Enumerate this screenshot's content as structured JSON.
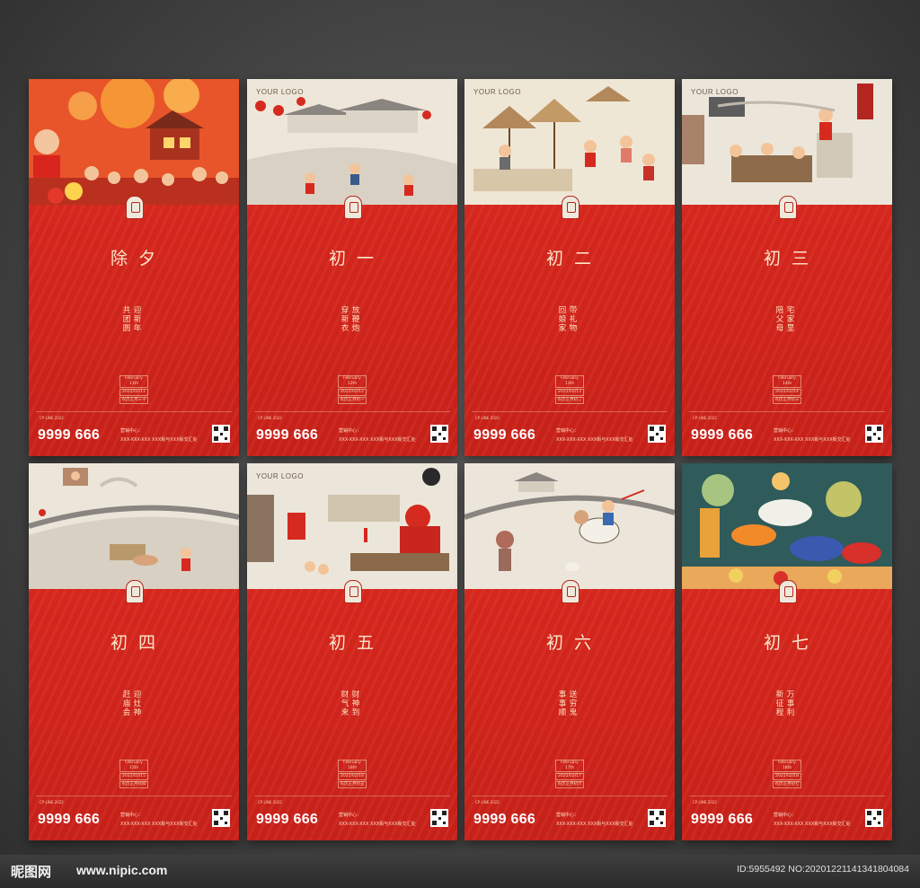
{
  "logo_text": "YOUR LOGO",
  "phone": "9999 666",
  "address_line1": "营销中心：",
  "address_line2": "XXX-XXX-XXX  XXX街与XXX街交汇处",
  "footer_small": "CP LINE 2022",
  "cards": [
    {
      "title": "除夕",
      "sub_a": "迎新年",
      "sub_b": "共团圆",
      "date_en": "February 11th",
      "date_num": "2021/02/11",
      "date_cn": "农历正月三十",
      "scene": "fireworks"
    },
    {
      "title": "初一",
      "sub_a": "放鞭炮",
      "sub_b": "穿新衣",
      "date_en": "February 12th",
      "date_num": "2021/02/12",
      "date_cn": "农历正月初一",
      "scene": "village"
    },
    {
      "title": "初二",
      "sub_a": "带礼物",
      "sub_b": "回娘家",
      "date_en": "February 13th",
      "date_num": "2021/02/13",
      "date_cn": "农历正月初二",
      "scene": "market"
    },
    {
      "title": "初三",
      "sub_a": "宅家里",
      "sub_b": "陪父母",
      "date_en": "February 14th",
      "date_num": "2021/02/14",
      "date_cn": "农历正月初三",
      "scene": "home"
    },
    {
      "title": "初四",
      "sub_a": "迎灶神",
      "sub_b": "赶庙会",
      "date_en": "February 15th",
      "date_num": "2021/02/15",
      "date_cn": "农历正月初四",
      "scene": "courtyard"
    },
    {
      "title": "初五",
      "sub_a": "财神到",
      "sub_b": "财气来",
      "date_en": "February 16th",
      "date_num": "2021/02/16",
      "date_cn": "农历正月初五",
      "scene": "godwealth"
    },
    {
      "title": "初六",
      "sub_a": "送穷鬼",
      "sub_b": "事事顺",
      "date_en": "February 17th",
      "date_num": "2021/02/17",
      "date_cn": "农历正月初六",
      "scene": "horse"
    },
    {
      "title": "初七",
      "sub_a": "万事利",
      "sub_b": "新征程",
      "date_en": "February 18th",
      "date_num": "2021/02/18",
      "date_cn": "农历正月初七",
      "scene": "parade"
    }
  ],
  "watermark_site": "昵图网",
  "watermark_url": "www.nipic.com",
  "watermark_id": "ID:5955492 NO:20201221141341804084"
}
